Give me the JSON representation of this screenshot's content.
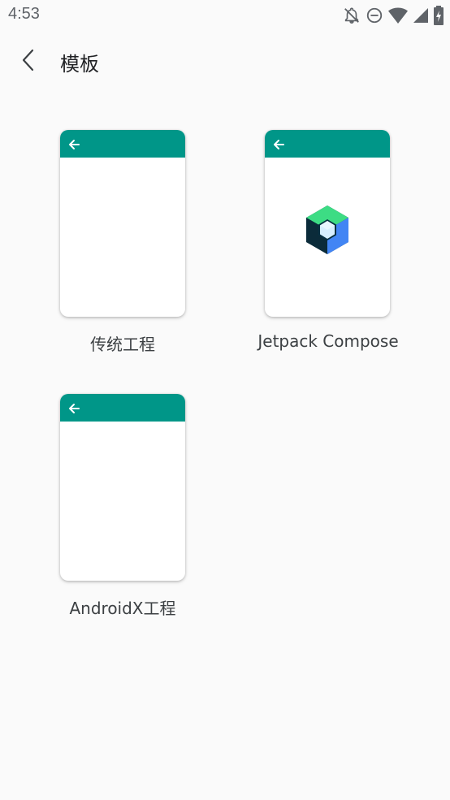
{
  "status_bar": {
    "time": "4:53",
    "icons": [
      "notifications-off-icon",
      "do-not-disturb-icon",
      "wifi-icon",
      "cellular-icon",
      "battery-charging-icon"
    ]
  },
  "toolbar": {
    "back_icon": "chevron-left-icon",
    "title": "模板"
  },
  "templates": [
    {
      "label": "传统工程",
      "icon": "back-arrow-icon"
    },
    {
      "label": "Jetpack Compose",
      "icon": "back-arrow-icon",
      "logo": "jetpack-compose-logo"
    },
    {
      "label": "AndroidX工程",
      "icon": "back-arrow-icon"
    }
  ],
  "colors": {
    "appbar": "#009688",
    "background": "#fafafa",
    "card": "#ffffff"
  }
}
